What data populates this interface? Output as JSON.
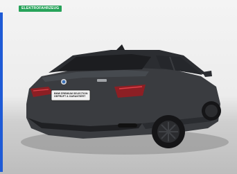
{
  "badge": {
    "label": "ELEKTROFAHRZEUG"
  },
  "plate": {
    "line1": "BMW PREMIUM SELECTION",
    "line2": "GEPRÜFT & GARANTIERT"
  },
  "colors": {
    "badge": "#27a35a",
    "car_body": "#3a3c40",
    "accent_edge": "#1f5bd6"
  }
}
